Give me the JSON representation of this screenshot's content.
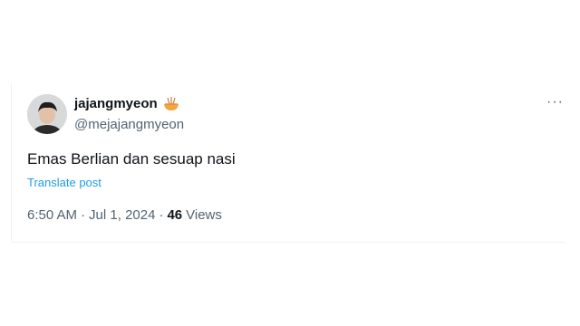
{
  "tweet": {
    "author": {
      "display_name": "jajangmyeon",
      "name_emoji": "noodle-bowl-icon",
      "handle": "@mejajangmyeon"
    },
    "more_icon": "more-dots-icon",
    "more_label": "···",
    "text": "Emas Berlian dan sesuap nasi",
    "translate_label": "Translate post",
    "time": "6:50 AM",
    "separator": "·",
    "date": "Jul 1, 2024",
    "views_count": "46",
    "views_label": "Views"
  },
  "colors": {
    "primary_text": "#0f1419",
    "secondary_text": "#536471",
    "link": "#1d9bf0",
    "border": "#eff3f4"
  }
}
